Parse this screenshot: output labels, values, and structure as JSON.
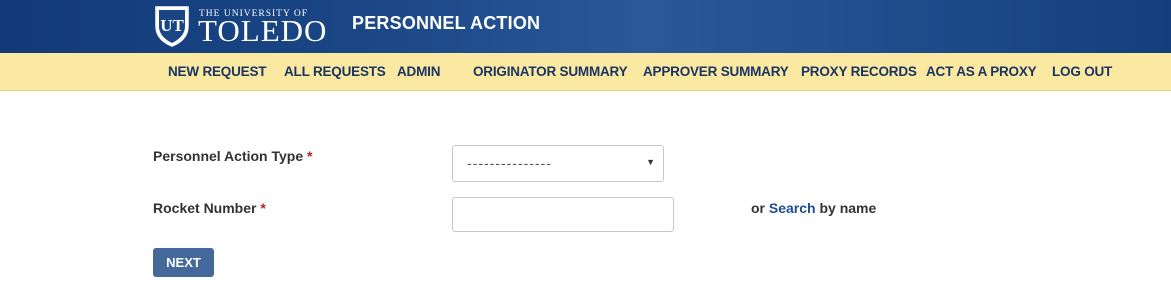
{
  "header": {
    "logo_small": "THE UNIVERSITY OF",
    "logo_big": "TOLEDO",
    "logo_mark": "UT",
    "app_title": "PERSONNEL ACTION"
  },
  "nav": {
    "items": [
      {
        "label": "NEW REQUEST"
      },
      {
        "label": "ALL REQUESTS"
      },
      {
        "label": "ADMIN"
      },
      {
        "label": "ORIGINATOR SUMMARY"
      },
      {
        "label": "APPROVER SUMMARY"
      },
      {
        "label": "PROXY RECORDS"
      },
      {
        "label": "ACT AS A PROXY"
      },
      {
        "label": "LOG OUT"
      }
    ]
  },
  "form": {
    "action_type_label": "Personnel Action Type",
    "required_marker": "*",
    "action_type_value": "---------------",
    "rocket_label": "Rocket Number",
    "rocket_value": "",
    "search_prefix": "or",
    "search_link": "Search",
    "search_suffix": "by name",
    "next_label": "NEXT"
  },
  "colors": {
    "header_blue": "#1a4686",
    "nav_yellow": "#fbe9a1",
    "nav_text": "#1a3563",
    "button_blue": "#44699a",
    "required_red": "#b3261e"
  }
}
